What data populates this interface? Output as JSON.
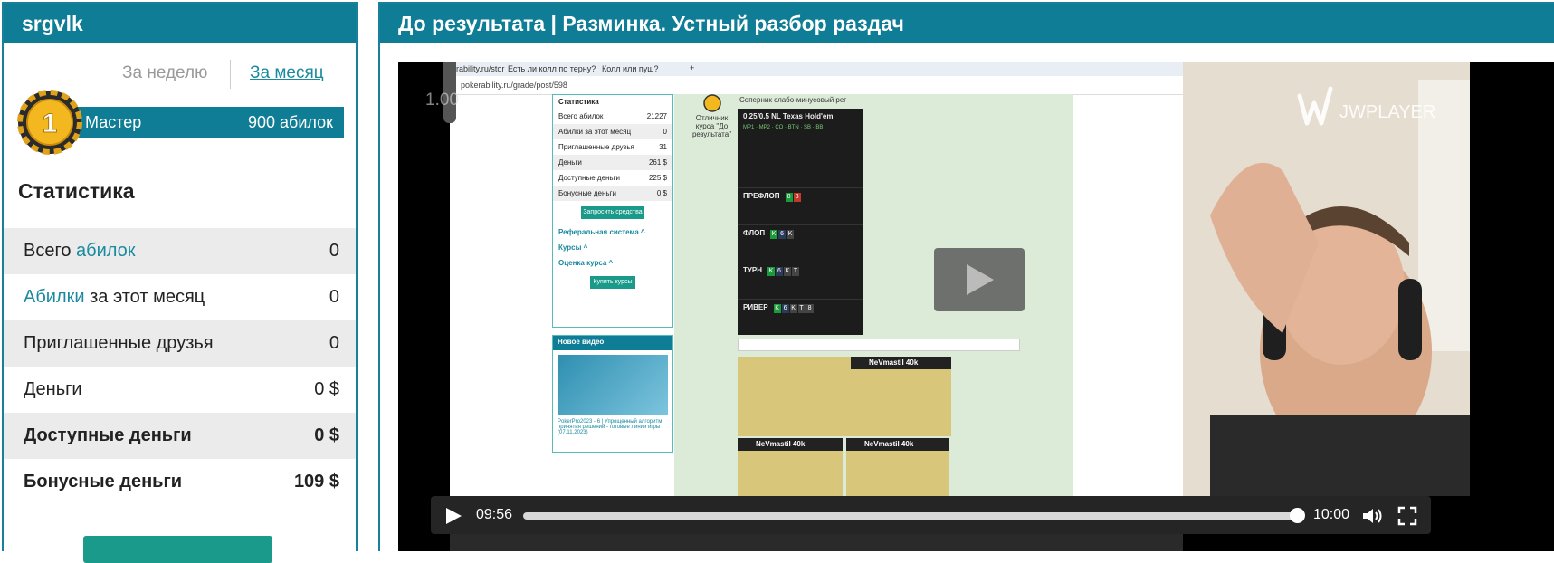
{
  "sidebar": {
    "username": "srgvlk",
    "tabs": {
      "week": "За неделю",
      "month": "За месяц"
    },
    "rank": {
      "name": "Мастер",
      "value": "900 абилок",
      "badge_number": "1"
    },
    "stats_title": "Статистика",
    "stats": [
      {
        "label_prefix": "Всего ",
        "label_link": "абилок",
        "label_suffix": "",
        "value": "0"
      },
      {
        "label_prefix": "",
        "label_link": "Абилки",
        "label_suffix": " за этот месяц",
        "value": "0"
      },
      {
        "label_prefix": "Приглашенные друзья",
        "label_link": "",
        "label_suffix": "",
        "value": "0"
      },
      {
        "label_prefix": "Деньги",
        "label_link": "",
        "label_suffix": "",
        "value": "0 $"
      },
      {
        "label_prefix": "Доступные деньги",
        "label_link": "",
        "label_suffix": "",
        "value": "0 $"
      },
      {
        "label_prefix": "Бонусные деньги",
        "label_link": "",
        "label_suffix": "",
        "value": "109 $"
      }
    ]
  },
  "main": {
    "title": "До результата | Разминка. Устный разбор раздач"
  },
  "video": {
    "speed": "1.00",
    "current_time": "09:56",
    "duration": "10:00",
    "progress": 0.993,
    "player_logo": "JWPLAYER",
    "screen": {
      "browser_tabs": [
        "erability.ru/stor",
        "Есть ли колл по терну?",
        "Колл или пуш?"
      ],
      "address": "pokerability.ru/grade/post/598",
      "panel_title": "Статистика",
      "panel_rows": [
        {
          "l": "Всего абилок",
          "v": "21227"
        },
        {
          "l": "Абилки за этот месяц",
          "v": "0"
        },
        {
          "l": "Приглашенные друзья",
          "v": "31"
        },
        {
          "l": "Деньги",
          "v": "261 $"
        },
        {
          "l": "Доступные деньги",
          "v": "225 $"
        },
        {
          "l": "Бонусные деньги",
          "v": "0 $"
        }
      ],
      "panel_button": "Запросить средства",
      "panel_links": [
        "Реферальная система ^",
        "Курсы ^",
        "Оценка курса ^"
      ],
      "panel_buy": "Купить курсы",
      "new_video_title": "Новое видео",
      "new_video_caption": "PokerPro2023 - 6 | Упрощенный алгоритм принятия решений - готовые линии игры (07.11.2023)",
      "coin_note": "Отличник курса \"До результата\"",
      "opponent_note": "Соперник слабо-минусовый рег",
      "hand_title": "0.25/0.5 NL Texas Hold'em",
      "streets": [
        "ПРЕФЛОП",
        "ФЛОП",
        "ТУРН",
        "РИВЕР"
      ],
      "hud_player": "NeVmastil",
      "hud_hands": "40k"
    }
  },
  "colors": {
    "header": "#0f7d95",
    "link": "#1a8aa0",
    "row_shade": "#ebebeb"
  }
}
